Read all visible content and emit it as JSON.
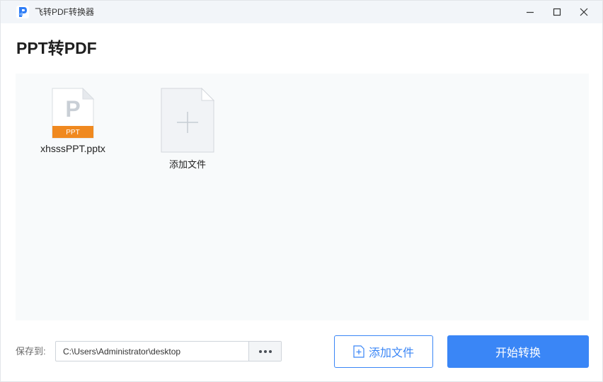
{
  "window": {
    "title": "飞转PDF转换器",
    "logo_letter": "P",
    "accent_color": "#3a86f6"
  },
  "page": {
    "title": "PPT转PDF"
  },
  "files": [
    {
      "name": "xhsssPPT.pptx",
      "type_badge": "PPT",
      "icon_letter": "P",
      "badge_color": "#f0891f"
    }
  ],
  "add_tile": {
    "label": "添加文件",
    "icon": "plus-icon"
  },
  "footer": {
    "save_label": "保存到:",
    "save_path": "C:\\Users\\Administrator\\desktop",
    "browse_icon": "ellipsis-icon",
    "add_button_label": "添加文件",
    "start_button_label": "开始转换"
  }
}
